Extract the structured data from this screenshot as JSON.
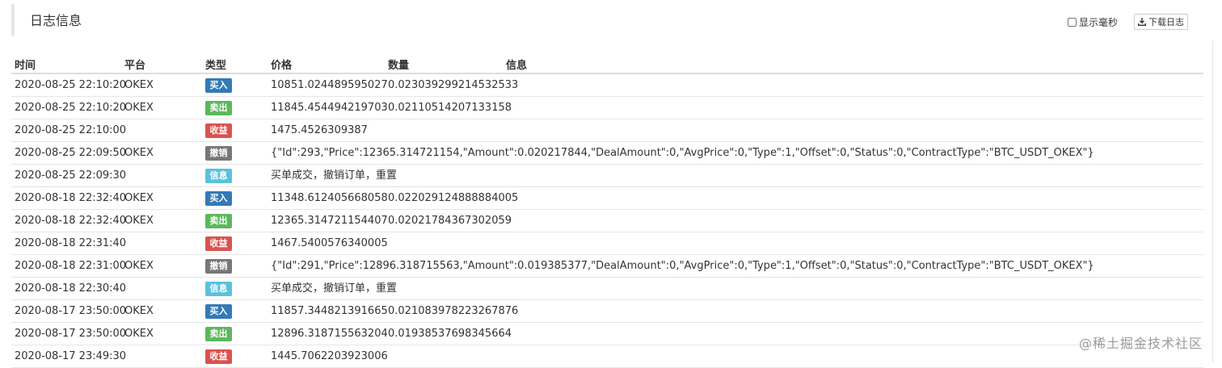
{
  "panel": {
    "title": "日志信息",
    "show_ms_label": "显示毫秒",
    "download_label": "下载日志"
  },
  "columns": {
    "time": "时间",
    "platform": "平台",
    "type": "类型",
    "price": "价格",
    "amount": "数量",
    "info": "信息"
  },
  "colors": {
    "buy": "#337ab7",
    "sell": "#5cb85c",
    "profit": "#d9534f",
    "cancel": "#777777",
    "info": "#5bc0de"
  },
  "rows": [
    {
      "time": "2020-08-25 22:10:20",
      "platform": "OKEX",
      "type": "买入",
      "kind": "buy",
      "price": "10851.024489595027",
      "amount": "0.023039299214532533"
    },
    {
      "time": "2020-08-25 22:10:20",
      "platform": "OKEX",
      "type": "卖出",
      "kind": "sell",
      "price": "11845.454494219703",
      "amount": "0.02110514207133158"
    },
    {
      "time": "2020-08-25 22:10:00",
      "platform": "",
      "type": "收益",
      "kind": "profit",
      "price": "1475.4526309387",
      "amount": ""
    },
    {
      "time": "2020-08-25 22:09:50",
      "platform": "OKEX",
      "type": "撤销",
      "kind": "cancel",
      "price": "{\"Id\":293,\"Price\":12365.314721154,\"Amount\":0.020217844,\"DealAmount\":0,\"AvgPrice\":0,\"Type\":1,\"Offset\":0,\"Status\":0,\"ContractType\":\"BTC_USDT_OKEX\"}",
      "amount": ""
    },
    {
      "time": "2020-08-25 22:09:30",
      "platform": "",
      "type": "信息",
      "kind": "info",
      "price": "买单成交，撤销订单，重置",
      "amount": ""
    },
    {
      "time": "2020-08-18 22:32:40",
      "platform": "OKEX",
      "type": "买入",
      "kind": "buy",
      "price": "11348.612405668058",
      "amount": "0.022029124888884005"
    },
    {
      "time": "2020-08-18 22:32:40",
      "platform": "OKEX",
      "type": "卖出",
      "kind": "sell",
      "price": "12365.314721154407",
      "amount": "0.02021784367302059"
    },
    {
      "time": "2020-08-18 22:31:40",
      "platform": "",
      "type": "收益",
      "kind": "profit",
      "price": "1467.5400576340005",
      "amount": ""
    },
    {
      "time": "2020-08-18 22:31:00",
      "platform": "OKEX",
      "type": "撤销",
      "kind": "cancel",
      "price": "{\"Id\":291,\"Price\":12896.318715563,\"Amount\":0.019385377,\"DealAmount\":0,\"AvgPrice\":0,\"Type\":1,\"Offset\":0,\"Status\":0,\"ContractType\":\"BTC_USDT_OKEX\"}",
      "amount": ""
    },
    {
      "time": "2020-08-18 22:30:40",
      "platform": "",
      "type": "信息",
      "kind": "info",
      "price": "买单成交，撤销订单，重置",
      "amount": ""
    },
    {
      "time": "2020-08-17 23:50:00",
      "platform": "OKEX",
      "type": "买入",
      "kind": "buy",
      "price": "11857.344821391665",
      "amount": "0.021083978223267876"
    },
    {
      "time": "2020-08-17 23:50:00",
      "platform": "OKEX",
      "type": "卖出",
      "kind": "sell",
      "price": "12896.318715563204",
      "amount": "0.01938537698345664"
    },
    {
      "time": "2020-08-17 23:49:30",
      "platform": "",
      "type": "收益",
      "kind": "profit",
      "price": "1445.7062203923006",
      "amount": ""
    }
  ],
  "watermark": "@稀土掘金技术社区"
}
